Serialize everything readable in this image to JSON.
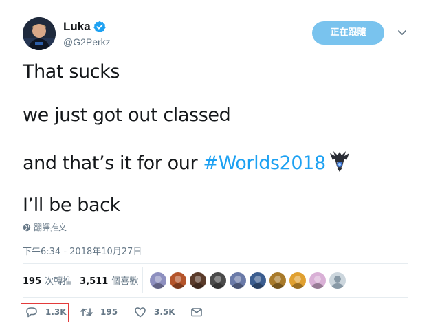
{
  "author": {
    "display_name": "Luka",
    "handle": "@G2Perkz",
    "verified": true,
    "avatar_icon": "avatar-photo"
  },
  "header": {
    "follow_label": "正在跟隨",
    "caret_icon": "chevron-down-icon"
  },
  "tweet": {
    "line1": "That sucks",
    "line2": "we just got out classed",
    "line3_prefix": "and that’s it for our ",
    "hashtag": "#Worlds2018",
    "hashtag_emoji_icon": "worlds-trophy-icon",
    "line4": "I’ll be back"
  },
  "translate": {
    "icon": "globe-icon",
    "label": "翻譯推文"
  },
  "timestamp": "下午6:34 - 2018年10月27日",
  "stats": {
    "retweets_count": "195",
    "retweets_label": "次轉推",
    "likes_count": "3,511",
    "likes_label": "個喜歡"
  },
  "likers": [
    {
      "name": "liker-1",
      "color": "#8d8fbf"
    },
    {
      "name": "liker-2",
      "color": "#b4542a"
    },
    {
      "name": "liker-3",
      "color": "#5a3b2a"
    },
    {
      "name": "liker-4",
      "color": "#4a4a4a"
    },
    {
      "name": "liker-5",
      "color": "#6a7aa8"
    },
    {
      "name": "liker-6",
      "color": "#3b5d8f"
    },
    {
      "name": "liker-7",
      "color": "#a87a2a"
    },
    {
      "name": "liker-8",
      "color": "#e0a030"
    },
    {
      "name": "liker-9",
      "color": "#d9b0d6"
    },
    {
      "name": "liker-10",
      "color": "#ccd6dd"
    }
  ],
  "actions": {
    "reply_count": "1.3K",
    "retweet_count": "195",
    "like_count": "3.5K"
  },
  "colors": {
    "accent": "#1da1f2",
    "follow_button": "#79c3ee",
    "highlight": "#e33b3b",
    "secondary_text": "#657786"
  }
}
